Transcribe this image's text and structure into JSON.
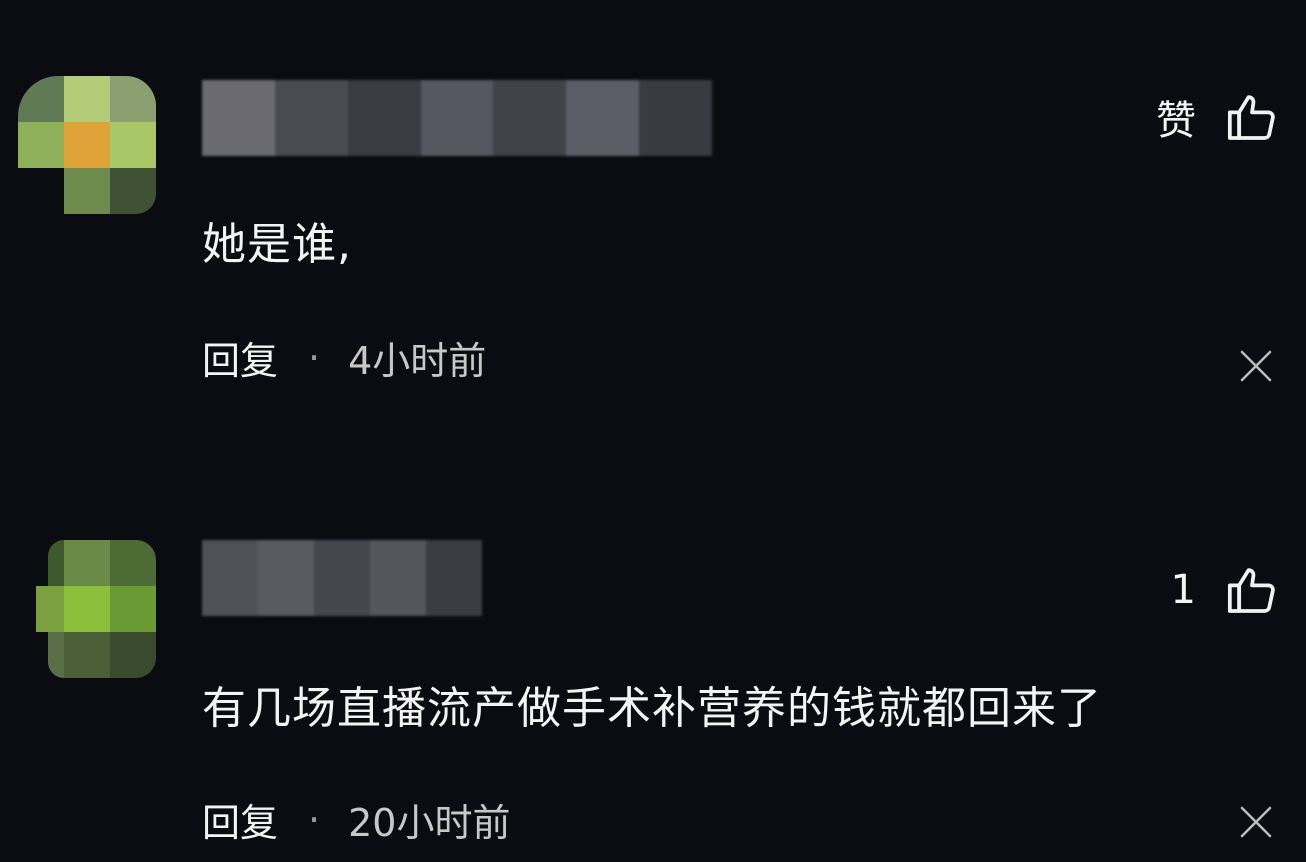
{
  "comments": [
    {
      "text": "她是谁,",
      "reply_label": "回复",
      "separator": "·",
      "time": "4小时前",
      "like_label": "赞",
      "avatar_colors": [
        "#5f7a55",
        "#b4cc78",
        "#8aa070",
        "#8fb05a",
        "#e0a33a",
        "#a8c868",
        "#2c3a2a",
        "#6e8a4c",
        "#3f5234"
      ],
      "username_colors": [
        "#6a6a70",
        "#4a4a52",
        "#3b3b44",
        "#565660",
        "#42424a",
        "#5c5c66",
        "#3a3a42"
      ]
    },
    {
      "text": "有几场直播流产做手术补营养的钱就都回来了",
      "reply_label": "回复",
      "separator": "·",
      "time": "20小时前",
      "like_label": "1",
      "avatar_colors": [
        "#3e5a2c",
        "#6a8a48",
        "#4d6b35",
        "#7aa040",
        "#8cbf3c",
        "#6a9a34",
        "#5a6e48",
        "#4a5e38",
        "#3a4a2c"
      ],
      "username_colors": [
        "#505058",
        "#5a5a62",
        "#46464e",
        "#55555e",
        "#3c3c44"
      ]
    }
  ],
  "icons": {
    "like": "thumbs-up-icon",
    "close": "close-icon"
  }
}
